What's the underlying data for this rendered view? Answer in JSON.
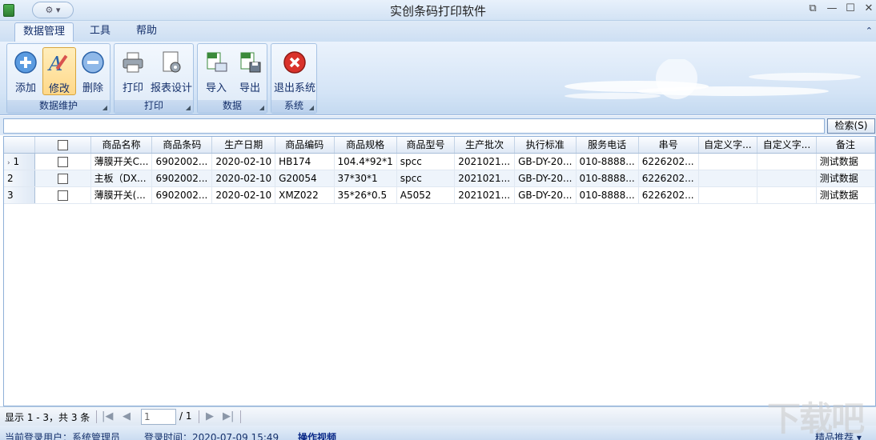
{
  "window": {
    "title": "实创条码打印软件",
    "qat_label": "⚙ ▾"
  },
  "tabs": [
    {
      "label": "数据管理",
      "active": true
    },
    {
      "label": "工具",
      "active": false
    },
    {
      "label": "帮助",
      "active": false
    }
  ],
  "ribbon": {
    "groups": [
      {
        "label": "数据维护",
        "buttons": [
          "添加",
          "修改",
          "删除"
        ]
      },
      {
        "label": "打印",
        "buttons": [
          "打印",
          "报表设计"
        ]
      },
      {
        "label": "数据",
        "buttons": [
          "导入",
          "导出"
        ]
      },
      {
        "label": "系统",
        "buttons": [
          "退出系统"
        ]
      }
    ]
  },
  "search": {
    "value": "",
    "button": "检索(S)"
  },
  "grid": {
    "columns": [
      "",
      "",
      "商品名称",
      "商品条码",
      "生产日期",
      "商品编码",
      "商品规格",
      "商品型号",
      "生产批次",
      "执行标准",
      "服务电话",
      "串号",
      "自定义字...",
      "自定义字...",
      "备注"
    ],
    "rows": [
      {
        "no": "1",
        "cells": [
          "薄膜开关C...",
          "6902002...",
          "2020-02-10",
          "HB174",
          "104.4*92*1",
          "spcc",
          "2021021...",
          "GB-DY-20...",
          "010-8888...",
          "6226202...",
          "",
          "",
          "测试数据"
        ]
      },
      {
        "no": "2",
        "cells": [
          "主板（DX...",
          "6902002...",
          "2020-02-10",
          "G20054",
          "37*30*1",
          "spcc",
          "2021021...",
          "GB-DY-20...",
          "010-8888...",
          "6226202...",
          "",
          "",
          "测试数据"
        ]
      },
      {
        "no": "3",
        "cells": [
          "薄膜开关(...",
          "6902002...",
          "2020-02-10",
          "XMZ022",
          "35*26*0.5",
          "A5052",
          "2021021...",
          "GB-DY-20...",
          "010-8888...",
          "6226202...",
          "",
          "",
          "测试数据"
        ]
      }
    ]
  },
  "pager": {
    "summary": "显示 1 - 3，共 3 条",
    "page": "1",
    "total": "/ 1"
  },
  "status": {
    "user": "当前登录用户：系统管理员",
    "login_time": "登录时间：2020-07-09 15:49",
    "video": "操作视频",
    "recommend": "精品推荐 ▾"
  },
  "watermark": "下载吧",
  "colors": {
    "accent": "#15306b",
    "ribbon_bg": "#d4e4f6",
    "selected_button": "#ffd889"
  }
}
